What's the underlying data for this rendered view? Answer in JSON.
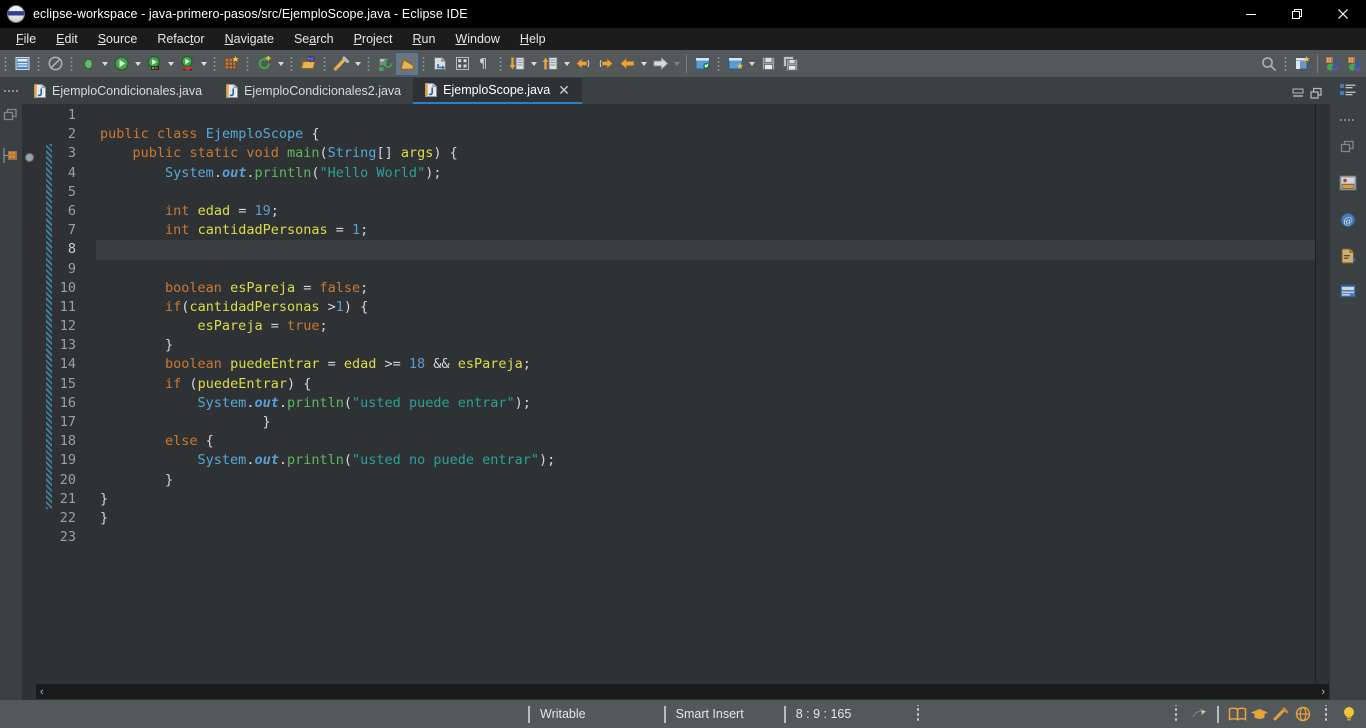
{
  "window": {
    "title": "eclipse-workspace - java-primero-pasos/src/EjemploScope.java - Eclipse IDE",
    "logo_icon": "eclipse-logo-icon",
    "minimize_label": "minimize-icon",
    "maximize_label": "restore-icon",
    "close_label": "close-icon"
  },
  "menubar": {
    "items": [
      {
        "label": "File",
        "mnemonic": "F"
      },
      {
        "label": "Edit",
        "mnemonic": "E"
      },
      {
        "label": "Source",
        "mnemonic": "S"
      },
      {
        "label": "Refactor",
        "mnemonic": "t"
      },
      {
        "label": "Navigate",
        "mnemonic": "N"
      },
      {
        "label": "Search",
        "mnemonic": "a"
      },
      {
        "label": "Project",
        "mnemonic": "P"
      },
      {
        "label": "Run",
        "mnemonic": "R"
      },
      {
        "label": "Window",
        "mnemonic": "W"
      },
      {
        "label": "Help",
        "mnemonic": "H"
      }
    ]
  },
  "toolbar": {
    "groups": [
      {
        "icons": [
          "new-wizard-icon"
        ]
      },
      {
        "icons": [
          "no-entry-icon"
        ]
      },
      {
        "icons": [
          "debug-icon"
        ],
        "dropdown": true
      },
      {
        "icons": [
          "run-icon"
        ],
        "dropdown": true
      },
      {
        "icons": [
          "run-coverage-icon"
        ],
        "dropdown": true
      },
      {
        "icons": [
          "run-external-tools-icon"
        ],
        "dropdown": true
      },
      {
        "icons": [
          "new-java-project-icon"
        ]
      },
      {
        "icons": [
          "refresh-icon"
        ],
        "dropdown": true
      },
      {
        "icons": [
          "open-type-icon"
        ]
      },
      {
        "icons": [
          "quick-fix-icon"
        ],
        "dropdown": true
      },
      {
        "icons": [
          "skip-breakpoints-icon"
        ]
      },
      {
        "icons": [
          "java-perspective-icon"
        ],
        "selected": true
      },
      {
        "icons": [
          "new-java-class-icon"
        ]
      },
      {
        "icons": [
          "open-task-icon"
        ]
      },
      {
        "icons": [
          "show-whitespace-icon"
        ]
      },
      {
        "icons": [
          "next-annotation-icon"
        ],
        "dropdown": true
      },
      {
        "icons": [
          "previous-annotation-icon"
        ],
        "dropdown": true
      },
      {
        "icons": [
          "back-history-icon",
          "forward-history-icon"
        ]
      },
      {
        "icons": [
          "back-arrow-icon"
        ],
        "dropdown": true
      },
      {
        "icons": [
          "forward-arrow-icon"
        ],
        "dropdown": true,
        "dimmed": true
      },
      {
        "icons": [
          "new-package-icon"
        ]
      },
      {
        "icons": [
          "new-folder-icon"
        ],
        "dropdown": true
      },
      {
        "icons": [
          "save-icon"
        ]
      },
      {
        "icons": [
          "save-all-icon"
        ]
      }
    ],
    "right_icons": [
      "search-icon",
      "open-perspective-icon",
      "java-perspective-tab-icon",
      "java-browsing-perspective-icon"
    ]
  },
  "tabs": [
    {
      "label": "EjemploCondicionales.java",
      "active": false,
      "icon": "java-file-icon",
      "closable": false
    },
    {
      "label": "EjemploCondicionales2.java",
      "active": false,
      "icon": "java-file-icon",
      "closable": false
    },
    {
      "label": "EjemploScope.java",
      "active": true,
      "icon": "java-file-icon",
      "closable": true
    }
  ],
  "tabbar_controls": {
    "minimize": "minimize-view-icon",
    "maximize": "maximize-view-icon"
  },
  "left_rail": {
    "icons": [
      "restore-view-icon",
      "package-explorer-icon",
      "outline-stack-icon"
    ]
  },
  "right_rail": {
    "icons": [
      "outline-icon",
      "grip-dots",
      "restore-icon",
      "problems-icon",
      "javadoc-icon",
      "declaration-icon",
      "console-icon"
    ]
  },
  "editor": {
    "current_line": 8,
    "breakpoint_line": 3,
    "fold_range": {
      "from": 3,
      "to": 21
    },
    "lines": [
      {
        "n": 1,
        "tokens": []
      },
      {
        "n": 2,
        "tokens": [
          {
            "t": "public",
            "c": "kw"
          },
          {
            "t": " ",
            "c": "pln"
          },
          {
            "t": "class",
            "c": "kw"
          },
          {
            "t": " ",
            "c": "pln"
          },
          {
            "t": "EjemploScope",
            "c": "type"
          },
          {
            "t": " {",
            "c": "pln"
          }
        ]
      },
      {
        "n": 3,
        "tokens": [
          {
            "t": "    ",
            "c": "pln"
          },
          {
            "t": "public",
            "c": "kw"
          },
          {
            "t": " ",
            "c": "pln"
          },
          {
            "t": "static",
            "c": "kw"
          },
          {
            "t": " ",
            "c": "pln"
          },
          {
            "t": "void",
            "c": "kw"
          },
          {
            "t": " ",
            "c": "pln"
          },
          {
            "t": "main",
            "c": "mth"
          },
          {
            "t": "(",
            "c": "pln"
          },
          {
            "t": "String",
            "c": "type"
          },
          {
            "t": "[] ",
            "c": "pln"
          },
          {
            "t": "args",
            "c": "fld"
          },
          {
            "t": ") {",
            "c": "pln"
          }
        ]
      },
      {
        "n": 4,
        "tokens": [
          {
            "t": "        ",
            "c": "pln"
          },
          {
            "t": "System",
            "c": "type"
          },
          {
            "t": ".",
            "c": "pln"
          },
          {
            "t": "out",
            "c": "stat"
          },
          {
            "t": ".",
            "c": "pln"
          },
          {
            "t": "println",
            "c": "mth"
          },
          {
            "t": "(",
            "c": "pln"
          },
          {
            "t": "\"Hello World\"",
            "c": "str"
          },
          {
            "t": ");",
            "c": "pln"
          }
        ]
      },
      {
        "n": 5,
        "tokens": []
      },
      {
        "n": 6,
        "tokens": [
          {
            "t": "        ",
            "c": "pln"
          },
          {
            "t": "int",
            "c": "kw"
          },
          {
            "t": " ",
            "c": "pln"
          },
          {
            "t": "edad",
            "c": "fld"
          },
          {
            "t": " = ",
            "c": "pln"
          },
          {
            "t": "19",
            "c": "num"
          },
          {
            "t": ";",
            "c": "pln"
          }
        ]
      },
      {
        "n": 7,
        "tokens": [
          {
            "t": "        ",
            "c": "pln"
          },
          {
            "t": "int",
            "c": "kw"
          },
          {
            "t": " ",
            "c": "pln"
          },
          {
            "t": "cantidadPersonas",
            "c": "fld"
          },
          {
            "t": " = ",
            "c": "pln"
          },
          {
            "t": "1",
            "c": "num"
          },
          {
            "t": ";",
            "c": "pln"
          }
        ]
      },
      {
        "n": 8,
        "tokens": []
      },
      {
        "n": 9,
        "tokens": []
      },
      {
        "n": 10,
        "tokens": [
          {
            "t": "        ",
            "c": "pln"
          },
          {
            "t": "boolean",
            "c": "kw"
          },
          {
            "t": " ",
            "c": "pln"
          },
          {
            "t": "esPareja",
            "c": "fld"
          },
          {
            "t": " = ",
            "c": "pln"
          },
          {
            "t": "false",
            "c": "kw"
          },
          {
            "t": ";",
            "c": "pln"
          }
        ]
      },
      {
        "n": 11,
        "tokens": [
          {
            "t": "        ",
            "c": "pln"
          },
          {
            "t": "if",
            "c": "kw"
          },
          {
            "t": "(",
            "c": "pln"
          },
          {
            "t": "cantidadPersonas",
            "c": "fld"
          },
          {
            "t": " >",
            "c": "pln"
          },
          {
            "t": "1",
            "c": "num"
          },
          {
            "t": ") {",
            "c": "pln"
          }
        ]
      },
      {
        "n": 12,
        "tokens": [
          {
            "t": "            ",
            "c": "pln"
          },
          {
            "t": "esPareja",
            "c": "fld"
          },
          {
            "t": " = ",
            "c": "pln"
          },
          {
            "t": "true",
            "c": "kw"
          },
          {
            "t": ";",
            "c": "pln"
          }
        ]
      },
      {
        "n": 13,
        "tokens": [
          {
            "t": "        }",
            "c": "pln"
          }
        ]
      },
      {
        "n": 14,
        "tokens": [
          {
            "t": "        ",
            "c": "pln"
          },
          {
            "t": "boolean",
            "c": "kw"
          },
          {
            "t": " ",
            "c": "pln"
          },
          {
            "t": "puedeEntrar",
            "c": "fld"
          },
          {
            "t": " = ",
            "c": "pln"
          },
          {
            "t": "edad",
            "c": "fld"
          },
          {
            "t": " >= ",
            "c": "pln"
          },
          {
            "t": "18",
            "c": "num"
          },
          {
            "t": " && ",
            "c": "pln"
          },
          {
            "t": "esPareja",
            "c": "fld"
          },
          {
            "t": ";",
            "c": "pln"
          }
        ]
      },
      {
        "n": 15,
        "tokens": [
          {
            "t": "        ",
            "c": "pln"
          },
          {
            "t": "if",
            "c": "kw"
          },
          {
            "t": " (",
            "c": "pln"
          },
          {
            "t": "puedeEntrar",
            "c": "fld"
          },
          {
            "t": ") {",
            "c": "pln"
          }
        ]
      },
      {
        "n": 16,
        "tokens": [
          {
            "t": "            ",
            "c": "pln"
          },
          {
            "t": "System",
            "c": "type"
          },
          {
            "t": ".",
            "c": "pln"
          },
          {
            "t": "out",
            "c": "stat"
          },
          {
            "t": ".",
            "c": "pln"
          },
          {
            "t": "println",
            "c": "mth"
          },
          {
            "t": "(",
            "c": "pln"
          },
          {
            "t": "\"usted puede entrar\"",
            "c": "str"
          },
          {
            "t": ");",
            "c": "pln"
          }
        ]
      },
      {
        "n": 17,
        "tokens": [
          {
            "t": "                    }",
            "c": "pln"
          }
        ]
      },
      {
        "n": 18,
        "tokens": [
          {
            "t": "        ",
            "c": "pln"
          },
          {
            "t": "else",
            "c": "kw"
          },
          {
            "t": " {",
            "c": "pln"
          }
        ]
      },
      {
        "n": 19,
        "tokens": [
          {
            "t": "            ",
            "c": "pln"
          },
          {
            "t": "System",
            "c": "type"
          },
          {
            "t": ".",
            "c": "pln"
          },
          {
            "t": "out",
            "c": "stat"
          },
          {
            "t": ".",
            "c": "pln"
          },
          {
            "t": "println",
            "c": "mth"
          },
          {
            "t": "(",
            "c": "pln"
          },
          {
            "t": "\"usted no puede entrar\"",
            "c": "str"
          },
          {
            "t": ");",
            "c": "pln"
          }
        ]
      },
      {
        "n": 20,
        "tokens": [
          {
            "t": "        }",
            "c": "pln"
          }
        ]
      },
      {
        "n": 21,
        "tokens": [
          {
            "t": "}",
            "c": "pln"
          }
        ]
      },
      {
        "n": 22,
        "tokens": [
          {
            "t": "}",
            "c": "pln"
          }
        ]
      },
      {
        "n": 23,
        "tokens": []
      }
    ]
  },
  "scrollbars": {
    "vertical_up": "scroll-up-arrow",
    "horizontal_left": "‹",
    "horizontal_right": "›"
  },
  "statusbar": {
    "writable": "Writable",
    "insert_mode": "Smart Insert",
    "cursor_position": "8 : 9 : 165",
    "right_icons": [
      "quick-access-icon",
      "book-icon",
      "graduation-cap-icon",
      "pen-icon",
      "globe-icon",
      "lightbulb-icon"
    ]
  },
  "colors": {
    "title_bg": "#000000",
    "menu_bg": "#1c1c1c",
    "toolbar_bg": "#53585b",
    "editor_bg": "#2f3234",
    "current_line_bg": "#3a3d3f",
    "tab_active_underline": "#2a7fc9",
    "keyword": "#cc7832",
    "type": "#56a8d8",
    "string": "#2aa198",
    "number": "#5e9ccc",
    "field": "#dcdc4a",
    "method": "#5db85d",
    "static_field": "#5a9fd4"
  }
}
